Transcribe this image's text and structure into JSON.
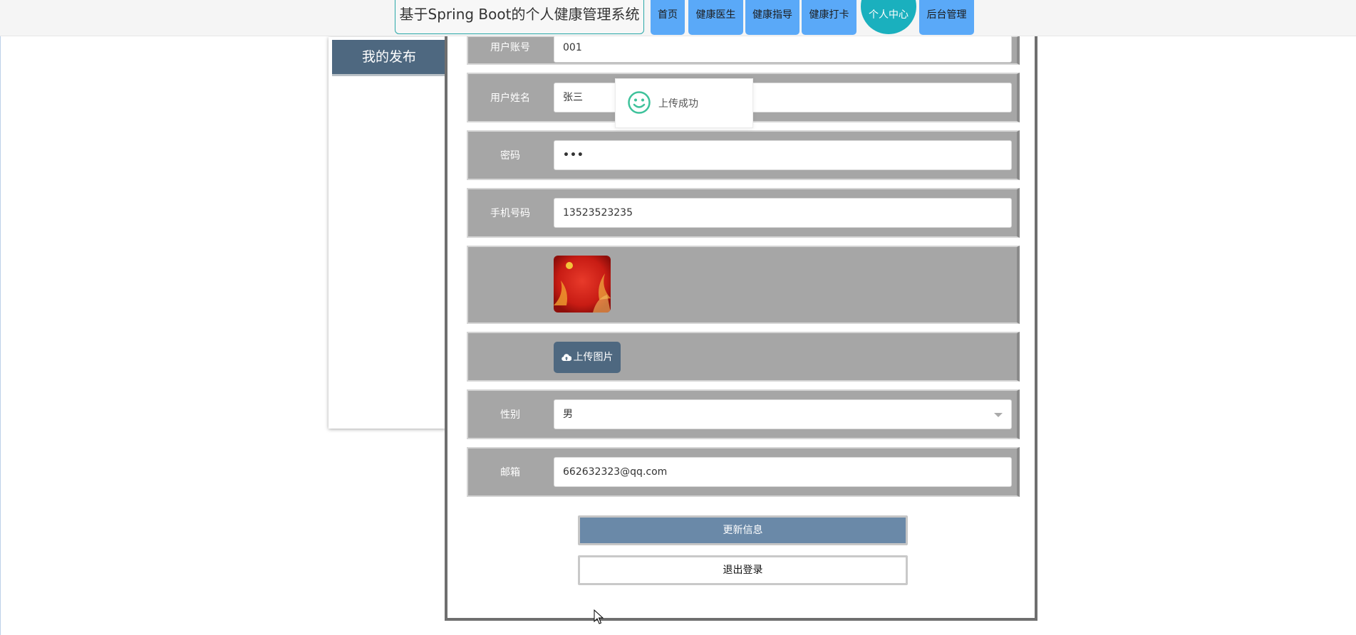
{
  "header": {
    "site_title": "基于Spring Boot的个人健康管理系统",
    "nav": [
      {
        "label": "首页"
      },
      {
        "label": "健康医生"
      },
      {
        "label": "健康指导"
      },
      {
        "label": "健康打卡"
      },
      {
        "label": "个人中心"
      },
      {
        "label": "后台管理"
      }
    ],
    "active_index": 4,
    "colors": {
      "nav": "#5aa9f8",
      "active": "#1ab0be"
    }
  },
  "sidebar": {
    "title": "我的发布"
  },
  "form": {
    "fields": {
      "account": {
        "label": "用户账号",
        "value": "001"
      },
      "name": {
        "label": "用户姓名",
        "value": "张三"
      },
      "password": {
        "label": "密码",
        "value": "•••"
      },
      "phone": {
        "label": "手机号码",
        "value": "13523523235"
      },
      "gender": {
        "label": "性别",
        "value": "男"
      },
      "email": {
        "label": "邮箱",
        "value": "662632323@qq.com"
      }
    },
    "upload_label": "上传图片",
    "update_button": "更新信息",
    "logout_button": "退出登录"
  },
  "toast": {
    "message": "上传成功",
    "icon": "smile-icon"
  }
}
